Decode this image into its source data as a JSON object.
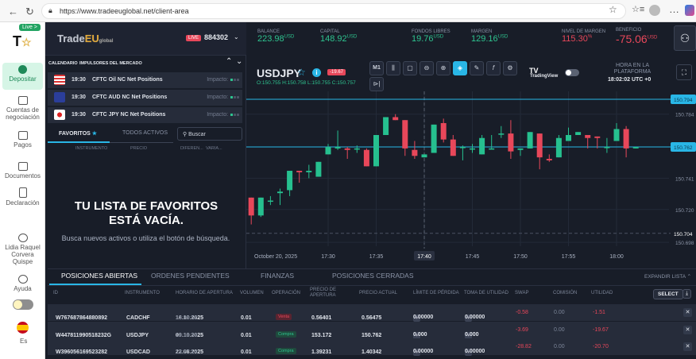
{
  "browser": {
    "url": "https://www.tradeeuglobal.net/client-area"
  },
  "sidebar": {
    "live_label": "Live >",
    "items": [
      {
        "label": "Depositar"
      },
      {
        "label": "Cuentas de negociación"
      },
      {
        "label": "Pagos"
      },
      {
        "label": "Documentos"
      },
      {
        "label": "Declaración"
      }
    ],
    "user_name": "Lidia Raquel Corvera Quispe",
    "help": "Ayuda",
    "language": "Es"
  },
  "header": {
    "logo": "TradeEU global",
    "live_badge": "LIVE",
    "account": "884302",
    "stats": [
      {
        "label": "BALANCE",
        "value": "223.98",
        "unit": "USD",
        "tone": "green"
      },
      {
        "label": "CAPITAL",
        "value": "148.92",
        "unit": "USD",
        "tone": "green"
      },
      {
        "label": "FONDOS LIBRES",
        "value": "19.76",
        "unit": "USD",
        "tone": "green"
      },
      {
        "label": "MARGEN",
        "value": "129.16",
        "unit": "USD",
        "tone": "green"
      },
      {
        "label": "NIVEL DE MARGEN",
        "value": "115.30",
        "unit": "%",
        "tone": "red"
      },
      {
        "label": "BENEFICIO",
        "value": "-75.06",
        "unit": "USD",
        "tone": "red"
      }
    ]
  },
  "calendar": {
    "tabs": [
      "CALENDARIO",
      "IMPULSORES DEL MERCADO"
    ],
    "events": [
      {
        "time": "19:30",
        "title": "CFTC Oil NC Net Positions",
        "impact_label": "Impacto:",
        "flag": "us"
      },
      {
        "time": "19:30",
        "title": "CFTC AUD NC Net Positions",
        "impact_label": "Impacto:",
        "flag": "au"
      },
      {
        "time": "19:30",
        "title": "CFTC JPY NC Net Positions",
        "impact_label": "Impacto:",
        "flag": "jp"
      }
    ]
  },
  "favorites": {
    "tabs": [
      "FAVORITOS",
      "TODOS ACTIVOS"
    ],
    "search_placeholder": "Buscar",
    "columns": [
      "INSTRUMENTO",
      "PRECIO",
      "DIFEREN...",
      "VARIA..."
    ],
    "empty_title": "TU LISTA DE FAVORITOS ESTÁ VACÍA.",
    "empty_subtitle": "Busca nuevos activos o utiliza el botón de búsqueda."
  },
  "chart": {
    "symbol": "USDJPY",
    "change_badge": "-19.67",
    "ohlc": {
      "o": "O:150.755",
      "h": "H:150.758",
      "l": "L:150.755",
      "c": "C:150.757"
    },
    "timeframe": "M1",
    "tradingview": "TradingView",
    "platform_time_label": "HORA EN LA PLATAFORMA",
    "platform_time": "18:02:02 UTC +0"
  },
  "chart_data": {
    "type": "candlestick",
    "x_start": "17:22",
    "interval_minutes": 1,
    "date_label": "October 20, 2025",
    "x_ticks": [
      "17:30",
      "17:35",
      "17:40",
      "17:45",
      "17:50",
      "17:55",
      "18:00"
    ],
    "crosshair_time": "17:40",
    "y_ticks": [
      "150.784",
      "150.741",
      "150.720",
      "150.698"
    ],
    "price_lines": [
      {
        "value": "150.794",
        "style": "solid-cyan"
      },
      {
        "value": "150.762",
        "style": "solid-cyan"
      },
      {
        "value": "150.704",
        "style": "dashed"
      }
    ],
    "ylim": [
      150.694,
      150.799
    ],
    "candles": [
      [
        150.728,
        150.728,
        150.71,
        150.716
      ],
      [
        150.716,
        150.728,
        150.715,
        150.728
      ],
      [
        150.726,
        150.729,
        150.723,
        150.726
      ],
      [
        150.731,
        150.734,
        150.723,
        150.732
      ],
      [
        150.733,
        150.746,
        150.729,
        150.746
      ],
      [
        150.746,
        150.746,
        150.738,
        150.745
      ],
      [
        150.745,
        150.75,
        150.741,
        150.746
      ],
      [
        150.742,
        150.752,
        150.742,
        150.752
      ],
      [
        150.757,
        150.764,
        150.757,
        150.762
      ],
      [
        150.761,
        150.773,
        150.76,
        150.762
      ],
      [
        150.761,
        150.762,
        150.754,
        150.76
      ],
      [
        150.761,
        150.763,
        150.758,
        150.761
      ],
      [
        150.76,
        150.761,
        150.749,
        150.749
      ],
      [
        150.749,
        150.77,
        150.749,
        150.77
      ],
      [
        150.77,
        150.782,
        150.77,
        150.782
      ],
      [
        150.782,
        150.784,
        150.78,
        150.78
      ],
      [
        150.78,
        150.78,
        150.756,
        150.761
      ],
      [
        150.76,
        150.766,
        150.754,
        150.756
      ],
      [
        150.755,
        150.757,
        150.755,
        150.757
      ],
      [
        150.758,
        150.777,
        150.758,
        150.777
      ],
      [
        150.778,
        150.781,
        150.765,
        150.767
      ],
      [
        150.767,
        150.77,
        150.756,
        150.756
      ],
      [
        150.762,
        150.763,
        150.753,
        150.762
      ],
      [
        150.761,
        150.764,
        150.758,
        150.761
      ],
      [
        150.757,
        150.77,
        150.757,
        150.768
      ],
      [
        150.761,
        150.77,
        150.761,
        150.761
      ],
      [
        150.771,
        150.776,
        150.768,
        150.771
      ],
      [
        150.771,
        150.78,
        150.754,
        150.759
      ],
      [
        150.76,
        150.761,
        150.756,
        150.761
      ],
      [
        150.761,
        150.772,
        150.761,
        150.772
      ],
      [
        150.771,
        150.771,
        150.747,
        150.755
      ],
      [
        150.754,
        150.757,
        150.752,
        150.753
      ],
      [
        150.755,
        150.77,
        150.755,
        150.768
      ],
      [
        150.766,
        150.775,
        150.766,
        150.77
      ],
      [
        150.77,
        150.772,
        150.77,
        150.772
      ],
      [
        150.77,
        150.77,
        150.761,
        150.768
      ],
      [
        150.769,
        150.769,
        150.761,
        150.768
      ],
      [
        150.762,
        150.768,
        150.758,
        150.762
      ],
      [
        150.766,
        150.778,
        150.766,
        150.774
      ],
      [
        150.774,
        150.776,
        150.755,
        150.761
      ],
      [
        150.761,
        150.762,
        150.761,
        150.762
      ]
    ]
  },
  "positions": {
    "tabs": [
      "POSICIONES ABIERTAS",
      "ORDENES PENDIENTES",
      "FINANZAS",
      "POSICIONES CERRADAS"
    ],
    "expand": "EXPANDIR LISTA",
    "select": "SELECT",
    "columns": [
      "ID",
      "INSTRUMENTO",
      "HORARIO DE APERTURA",
      "VOLUMEN",
      "OPERACIÓN",
      "PRECIO DE APERTURA",
      "PRECIO ACTUAL",
      "LÍMITE DE PÉRDIDA",
      "TOMA DE UTILIDAD",
      "SWAP",
      "COMISIÓN",
      "UTILIDAD"
    ],
    "rows": [
      {
        "id": "W767687864880892",
        "instrument": "CADCHF",
        "date": "16.10.2025",
        "time": "19:09:52",
        "volume": "0.01",
        "operation": "Venta",
        "open_price": "0.56401",
        "current_price": "0.56475",
        "stop_loss": "0.00000",
        "take_profit": "0.00000",
        "swap": "-0.58",
        "commission": "0.00",
        "profit": "-1.51"
      },
      {
        "id": "W447811990518232G",
        "instrument": "USDJPY",
        "date": "09.10.2025",
        "time": "19:18:39",
        "volume": "0.01",
        "operation": "Compra",
        "open_price": "153.172",
        "current_price": "150.762",
        "stop_loss": "0.000",
        "take_profit": "0.000",
        "swap": "-3.69",
        "commission": "0.00",
        "profit": "-19.67"
      },
      {
        "id": "W396056169523282",
        "instrument": "USDCAD",
        "date": "22.08.2025",
        "time": "13:27:14",
        "volume": "0.01",
        "operation": "Compra",
        "open_price": "1.39231",
        "current_price": "1.40342",
        "stop_loss": "0.00000",
        "take_profit": "0.00000",
        "swap": "-28.82",
        "commission": "0.00",
        "profit": "-20.70"
      }
    ]
  }
}
